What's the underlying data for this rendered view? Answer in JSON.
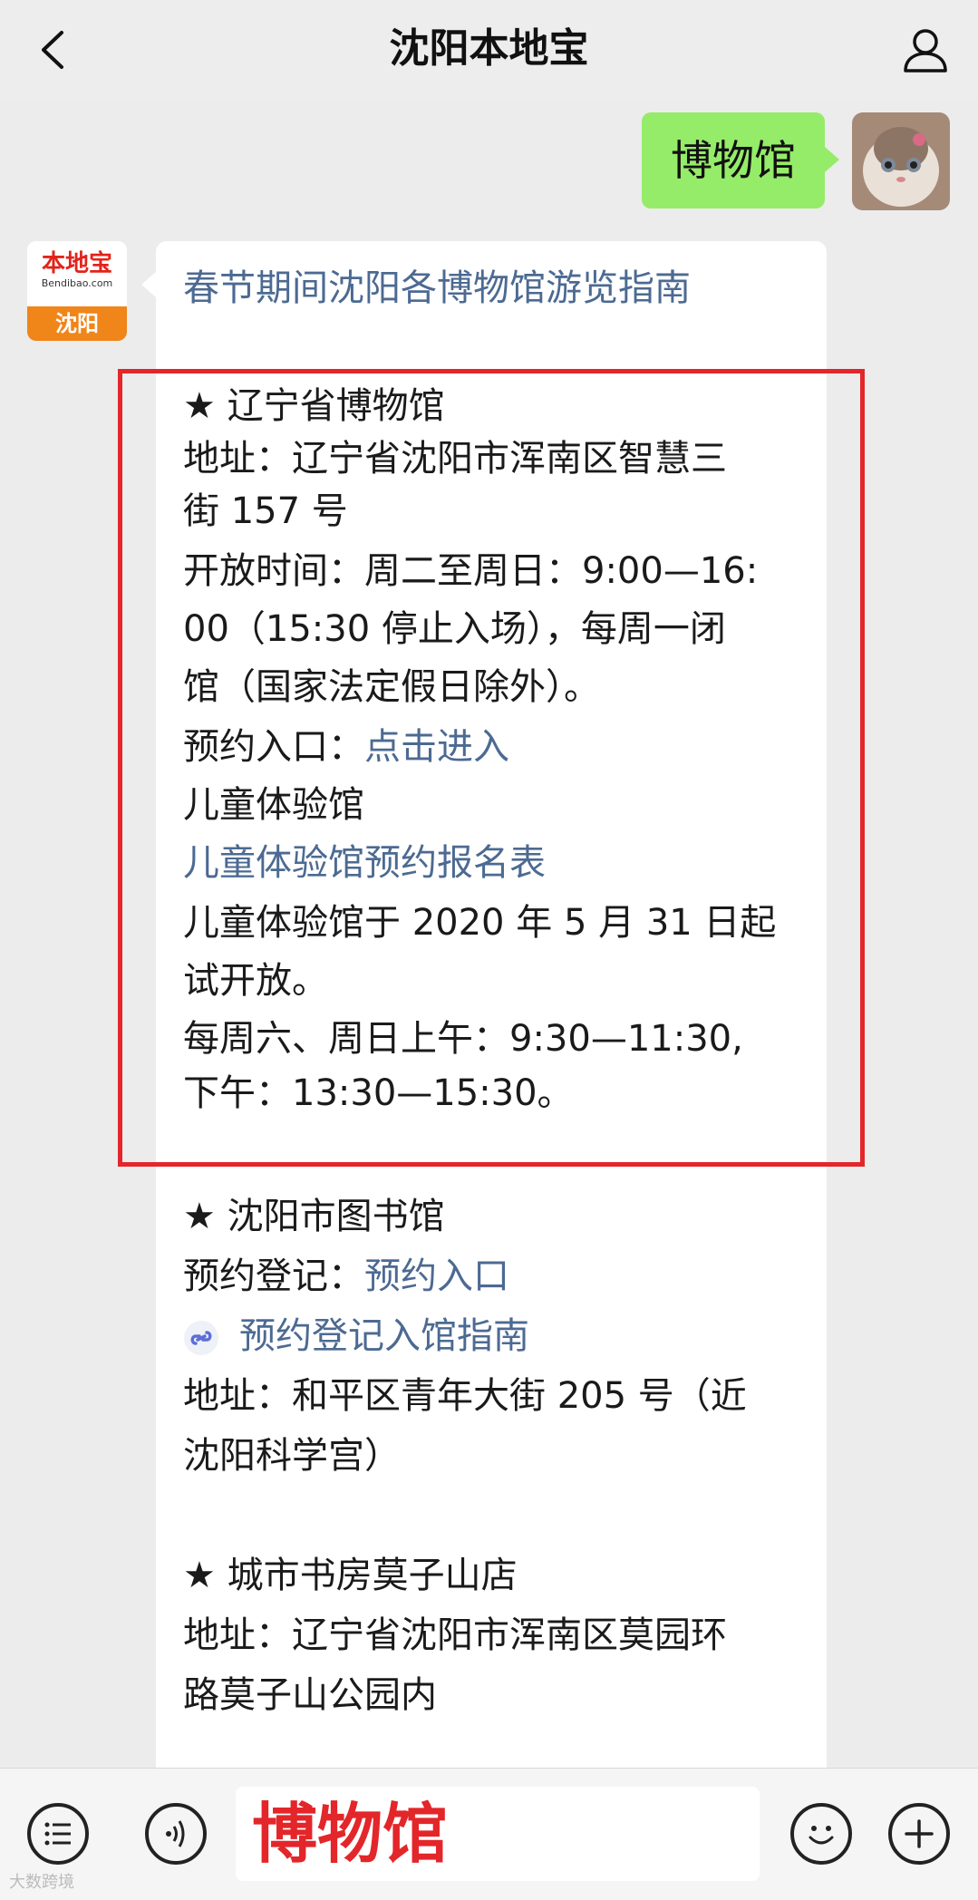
{
  "header": {
    "title": "沈阳本地宝"
  },
  "outgoing": {
    "text": "博物馆"
  },
  "bot": {
    "brand": "本地宝",
    "brand_sub": "Bendibao.com",
    "city": "沈阳"
  },
  "message": {
    "title": "春节期间沈阳各博物馆游览指南",
    "museum1": {
      "name": "★ 辽宁省博物馆",
      "address_l1": "地址：辽宁省沈阳市浑南区智慧三",
      "address_l2": "街 157 号",
      "hours_l1": "开放时间：周二至周日：9:00—16:",
      "hours_l2": "00（15:30 停止入场），每周一闭",
      "hours_l3": "馆（国家法定假日除外）。",
      "booking_label": "预约入口：",
      "booking_link": "点击进入",
      "kids_hall": "儿童体验馆",
      "kids_form_link": "儿童体验馆预约报名表",
      "kids_open_l1": "儿童体验馆于 2020 年 5 月 31 日起",
      "kids_open_l2": "试开放。",
      "kids_time_l1": "每周六、周日上午：9:30—11:30,",
      "kids_time_l2": "下午：13:30—15:30。"
    },
    "library": {
      "name": "★ 沈阳市图书馆",
      "register_label": "预约登记：",
      "register_link": "预约入口",
      "guide_link": "预约登记入馆指南",
      "address_l1": "地址：和平区青年大街 205 号（近",
      "address_l2": "沈阳科学宫）"
    },
    "bookstore": {
      "name": "★ 城市书房莫子山店",
      "address_l1": "地址：辽宁省沈阳市浑南区莫园环",
      "address_l2": "路莫子山公园内"
    }
  },
  "input": {
    "value": "博物馆"
  },
  "watermark": "大数跨境",
  "colors": {
    "highlight": "#e3262a",
    "link": "#4c6a92",
    "outgoing_bubble": "#95ec69"
  }
}
